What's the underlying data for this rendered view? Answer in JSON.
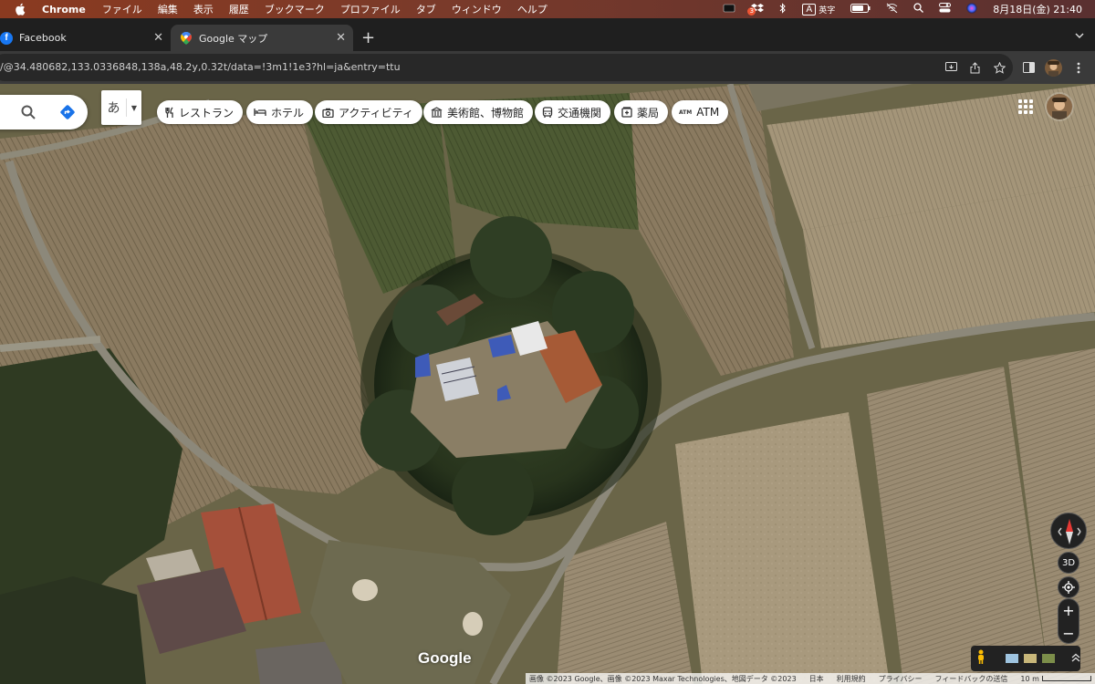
{
  "menubar": {
    "app_name": "Chrome",
    "items": [
      "ファイル",
      "編集",
      "表示",
      "履歴",
      "ブックマーク",
      "プロファイル",
      "タブ",
      "ウィンドウ",
      "ヘルプ"
    ],
    "ime_indicator": "A",
    "ime_label": "英字",
    "notification_count": "3",
    "clock": "8月18日(金)  21:40"
  },
  "tabs": [
    {
      "title": "Facebook",
      "icon": "facebook-icon"
    },
    {
      "title": "Google マップ",
      "icon": "google-maps-icon"
    }
  ],
  "address_bar": {
    "url": "/@34.480682,133.0336848,138a,48.2y,0.32t/data=!3m1!1e3?hl=ja&entry=ttu"
  },
  "map": {
    "ime_char": "あ",
    "chips": [
      {
        "label": "レストラン",
        "icon": "fork-knife-icon"
      },
      {
        "label": "ホテル",
        "icon": "bed-icon"
      },
      {
        "label": "アクティビティ",
        "icon": "camera-icon"
      },
      {
        "label": "美術館、博物館",
        "icon": "museum-icon"
      },
      {
        "label": "交通機関",
        "icon": "bus-icon"
      },
      {
        "label": "薬局",
        "icon": "pharmacy-icon"
      },
      {
        "label": "ATM",
        "icon": "atm-icon"
      }
    ],
    "view_3d_label": "3D",
    "google_logo": "Google",
    "attribution": {
      "imagery": "画像 ©2023 Google、画像 ©2023 Maxar Technologies、地図データ ©2023",
      "region": "日本",
      "terms": "利用規約",
      "privacy": "プライバシー",
      "feedback": "フィードバックの送信",
      "scale": "10 m"
    }
  },
  "colors": {
    "menubar": "#7a3a2a",
    "tab_active": "#3a3a3a",
    "omnibox": "#282828",
    "facebook_blue": "#1877f2",
    "maps_directions_blue": "#1a73e8"
  }
}
